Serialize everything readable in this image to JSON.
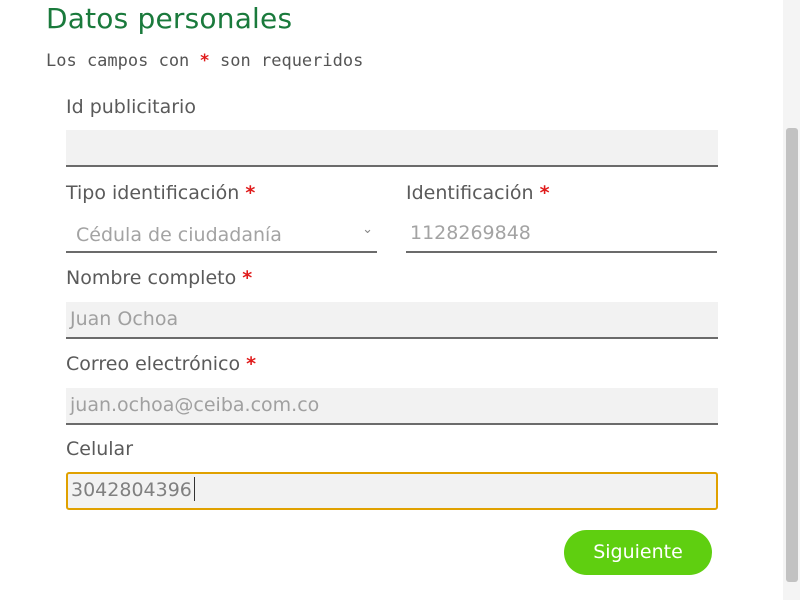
{
  "form": {
    "title": "Datos personales",
    "required_note_prefix": "Los campos con",
    "required_star": "*",
    "required_note_suffix": "son requeridos"
  },
  "fields": {
    "id_publicitario": {
      "label": "Id publicitario",
      "value": ""
    },
    "tipo_identificacion": {
      "label": "Tipo identificación",
      "required": "*",
      "selected": "Cédula de ciudadanía",
      "icon": "chevron-down-icon"
    },
    "identificacion": {
      "label": "Identificación",
      "required": "*",
      "value": "1128269848"
    },
    "nombre_completo": {
      "label": "Nombre completo",
      "required": "*",
      "value": "Juan Ochoa"
    },
    "correo": {
      "label": "Correo electrónico",
      "required": "*",
      "value": "juan.ochoa@ceiba.com.co"
    },
    "celular": {
      "label": "Celular",
      "value": "3042804396"
    }
  },
  "actions": {
    "next_label": "Siguiente"
  },
  "colors": {
    "title": "#1a7a3c",
    "required": "#e01b1b",
    "button": "#5fcf10",
    "focus_border": "#e0a100"
  }
}
